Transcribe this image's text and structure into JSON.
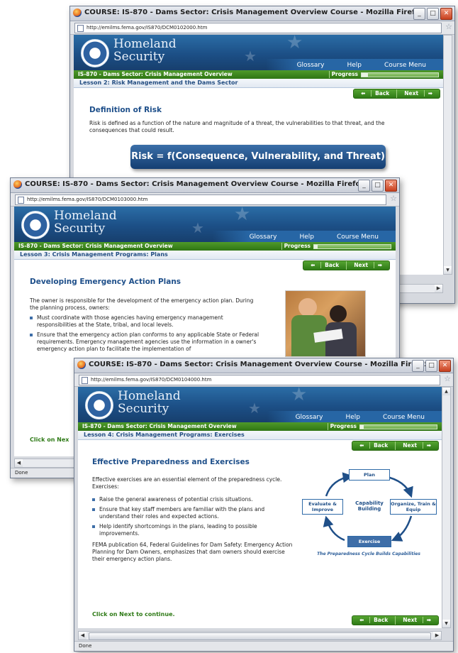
{
  "windows": [
    {
      "title": "COURSE: IS-870 - Dams Sector: Crisis Management Overview Course - Mozilla Firefox",
      "url": "http://emilms.fema.gov/IS870/DCM0102000.htm",
      "brand_line1": "Homeland",
      "brand_line2": "Security",
      "nav": [
        "Glossary",
        "Help",
        "Course Menu"
      ],
      "course_title": "IS-870 - Dams Sector: Crisis Management Overview",
      "progress_label": "Progress",
      "progress_fraction": 0.08,
      "lesson": "Lesson 2: Risk Management and the Dams Sector",
      "back": "Back",
      "next": "Next",
      "heading": "Definition of Risk",
      "body": "Risk is defined as a function of the nature and magnitude of a threat, the vulnerabilities to that threat, and the consequences that could result.",
      "formula": "Risk = f(Consequence, Vulnerability, and Threat)"
    },
    {
      "title": "COURSE: IS-870 - Dams Sector: Crisis Management Overview Course - Mozilla Firefox",
      "url": "http://emilms.fema.gov/IS870/DCM0103000.htm",
      "brand_line1": "Homeland",
      "brand_line2": "Security",
      "nav": [
        "Glossary",
        "Help",
        "Course Menu"
      ],
      "course_title": "IS-870 - Dams Sector: Crisis Management Overview",
      "progress_label": "Progress",
      "progress_fraction": 0.05,
      "lesson": "Lesson 3: Crisis Management Programs: Plans",
      "back": "Back",
      "next": "Next",
      "heading": "Developing Emergency Action Plans",
      "body": "The owner is responsible for the development of the emergency action plan. During the planning process, owners:",
      "bullets": [
        "Must coordinate with those agencies having emergency management responsibilities at the State, tribal, and local levels.",
        "Ensure that the emergency action plan conforms to any applicable State or Federal requirements. Emergency management agencies use the information in a owner's emergency action plan to facilitate the implementation of"
      ],
      "click_on": "Click on Nex",
      "status": "Done"
    },
    {
      "title": "COURSE: IS-870 - Dams Sector: Crisis Management Overview Course - Mozilla Firefox",
      "url": "http://emilms.fema.gov/IS870/DCM0104000.htm",
      "brand_line1": "Homeland",
      "brand_line2": "Security",
      "nav": [
        "Glossary",
        "Help",
        "Course Menu"
      ],
      "course_title": "IS-870 - Dams Sector: Crisis Management Overview",
      "progress_label": "Progress",
      "progress_fraction": 0.05,
      "lesson": "Lesson 4: Crisis Management Programs: Exercises",
      "back": "Back",
      "next": "Next",
      "heading": "Effective Preparedness and Exercises",
      "body": "Effective exercises are an essential element of the preparedness cycle.  Exercises:",
      "bullets": [
        "Raise the general awareness of potential crisis situations.",
        "Ensure that key staff members are familiar with the plans and understand their roles and expected actions.",
        "Help identify shortcomings in the plans, leading to possible improvements."
      ],
      "closing": "FEMA publication 64, Federal Guidelines for Dam Safety: Emergency Action Planning for Dam Owners, emphasizes that dam owners should exercise their emergency action plans.",
      "cycle": {
        "plan": "Plan",
        "organize": "Organize, Train & Equip",
        "exercise": "Exercise",
        "evaluate": "Evaluate & Improve",
        "center": "Capability Building",
        "caption": "The Preparedness Cycle Builds Capabilities"
      },
      "click_on": "Click on Next to continue.",
      "status": "Done"
    }
  ],
  "icons": {
    "browser": "firefox-icon",
    "minimize": "minimize-icon",
    "maximize": "maximize-icon",
    "close": "close-icon",
    "page": "page-icon",
    "bookmark": "star-icon",
    "back_arrow": "arrow-left-icon",
    "next_arrow": "arrow-right-icon"
  },
  "colors": {
    "banner": "#1c4f86",
    "course_bar": "#2f7514",
    "heading": "#1e4f8a",
    "click_on": "#2e7a16"
  }
}
